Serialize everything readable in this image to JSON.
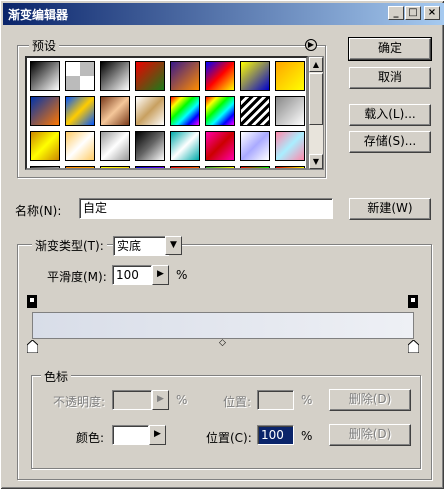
{
  "window": {
    "title": "渐变编辑器",
    "min_label": "_",
    "max_label": "□",
    "close_label": "×"
  },
  "presets": {
    "label": "预设",
    "menu_icon": "circle-arrow-icon",
    "swatches": [
      "linear-gradient(135deg,#000,#fff)",
      "repeating-conic-gradient(#bbb 0 25%,#fff 0 50%)",
      "linear-gradient(135deg,#000,#fff)",
      "linear-gradient(135deg,#e00,#1a7c1a)",
      "linear-gradient(135deg,#3a1a8a,#ff8c00)",
      "linear-gradient(135deg,#00f,#f00,#ff0)",
      "linear-gradient(135deg,#ff0,#00c)",
      "linear-gradient(135deg,#ffa500,#ff0)",
      "linear-gradient(135deg,#0033aa,#ff7700)",
      "linear-gradient(135deg,#0055ff,#ffcc00,#0055ff)",
      "linear-gradient(135deg,#7a3a1a,#f5c79a,#7a3a1a)",
      "linear-gradient(135deg,#fff,#c8a060,#fff)",
      "linear-gradient(135deg,#f00,#ff0,#0f0,#0ff,#00f,#f0f)",
      "linear-gradient(135deg,#f00,#ff0,#0f0,#0ff,#00f,#f0f)",
      "repeating-linear-gradient(135deg,#000 0 3px,#fff 3px 6px)",
      "linear-gradient(135deg,#888,#fff)",
      "linear-gradient(135deg,#c80,#ff0,#c80)",
      "linear-gradient(135deg,#ffcc66,#fff,#ffcc66)",
      "linear-gradient(135deg,#999,#fff,#999)",
      "linear-gradient(135deg,#000,#666,#fff)",
      "linear-gradient(135deg,#0aa,#fff,#0aa)",
      "linear-gradient(135deg,#f0a,#c00,#f0a)",
      "linear-gradient(135deg,#fff,#aaf,#fff)",
      "linear-gradient(135deg,#f8a,#aef,#f8a)",
      "linear-gradient(to right,#333,#999)",
      "linear-gradient(to right,#f80,#fa0)",
      "linear-gradient(to right,#ff0,#fd0)",
      "linear-gradient(to right,#00c,#60f)",
      "linear-gradient(to right,#e00,#f60)",
      "linear-gradient(to right,#3a3,#ff0)",
      "linear-gradient(to right,#f00,#0f0)",
      "linear-gradient(to right,#d00,#ff0)"
    ]
  },
  "buttons": {
    "ok": "确定",
    "cancel": "取消",
    "load": "载入(L)...",
    "save": "存储(S)...",
    "new": "新建(W)",
    "delete_opacity": "删除(D)",
    "delete_color": "删除(D)"
  },
  "name_field": {
    "label": "名称(N):",
    "value": "自定"
  },
  "gradient": {
    "type_label": "渐变类型(T):",
    "type_value": "实底",
    "smoothness_label": "平滑度(M):",
    "smoothness_value": "100",
    "smoothness_unit": "%"
  },
  "stops": {
    "group_label": "色标",
    "opacity_label": "不透明度:",
    "opacity_unit": "%",
    "location_label_opacity": "位置:",
    "location_unit_opacity": "%",
    "color_label": "颜色:",
    "location_label_color": "位置(C):",
    "location_value": "100",
    "location_unit_color": "%"
  }
}
